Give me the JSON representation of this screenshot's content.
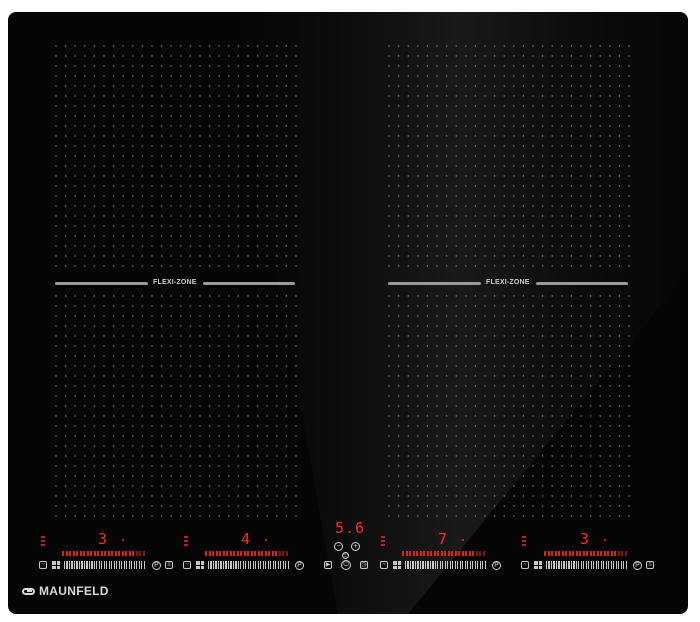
{
  "brand": {
    "name": "MAUNFELD",
    "logo_icon": "maunfeld-logo-icon"
  },
  "flexi_zones": [
    {
      "label": "FLEXI-ZONE"
    },
    {
      "label": "FLEXI-ZONE"
    }
  ],
  "center_display": {
    "value": "5.6"
  },
  "zones": [
    {
      "power_level": "3",
      "slider_level": 0.35
    },
    {
      "power_level": "4",
      "slider_level": 0.45
    },
    {
      "power_level": "7",
      "slider_level": 0.75
    },
    {
      "power_level": "3",
      "slider_level": 0.35
    }
  ],
  "colors": {
    "glass": "#050505",
    "display_red": "#ff2a1f",
    "print_grey": "#c8c8c8"
  },
  "icons": {
    "minus": "−",
    "plus": "+",
    "power": "⏻",
    "play": "▶",
    "clock": "◴",
    "pause": "P",
    "lock": "▣"
  }
}
